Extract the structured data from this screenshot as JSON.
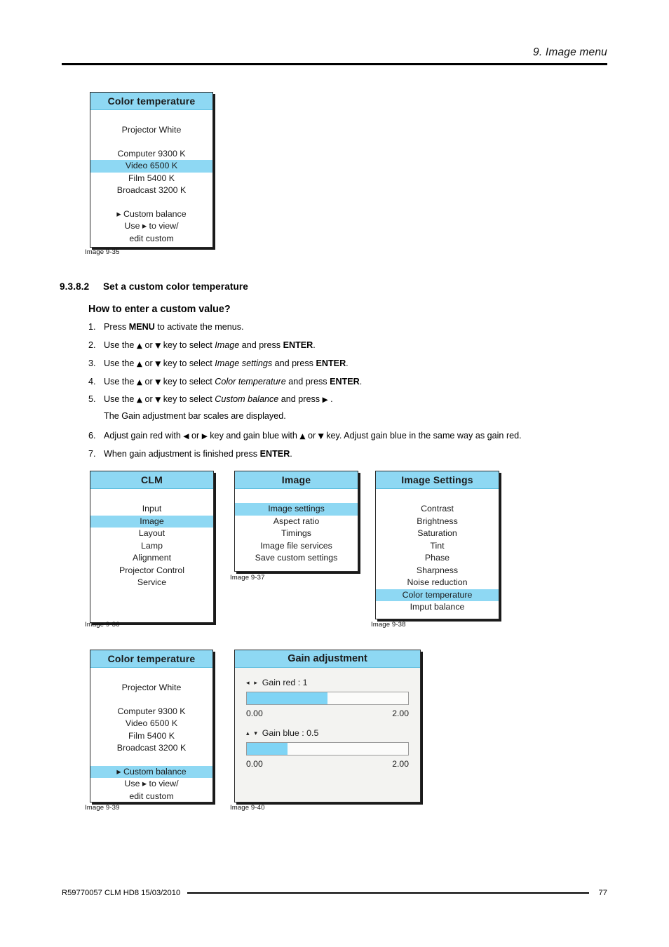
{
  "header": {
    "title": "9.  Image menu"
  },
  "section": {
    "number": "9.3.8.2",
    "title": "Set a custom color temperature",
    "subtitle": "How to enter a custom value?"
  },
  "steps": [
    {
      "n": "1.",
      "parts": [
        {
          "t": "Press ",
          "s": "plain"
        },
        {
          "t": "MENU",
          "s": "bold"
        },
        {
          "t": " to activate the menus.",
          "s": "plain"
        }
      ]
    },
    {
      "n": "2.",
      "parts": [
        {
          "t": "Use the ",
          "s": "plain"
        },
        {
          "t": "▲",
          "s": "arrow"
        },
        {
          "t": " or ",
          "s": "plain"
        },
        {
          "t": "▼",
          "s": "arrow"
        },
        {
          "t": " key to select ",
          "s": "plain"
        },
        {
          "t": "Image",
          "s": "italic"
        },
        {
          "t": " and press ",
          "s": "plain"
        },
        {
          "t": "ENTER",
          "s": "bold"
        },
        {
          "t": ".",
          "s": "plain"
        }
      ]
    },
    {
      "n": "3.",
      "parts": [
        {
          "t": "Use the ",
          "s": "plain"
        },
        {
          "t": "▲",
          "s": "arrow"
        },
        {
          "t": " or ",
          "s": "plain"
        },
        {
          "t": "▼",
          "s": "arrow"
        },
        {
          "t": " key to select ",
          "s": "plain"
        },
        {
          "t": "Image settings",
          "s": "italic"
        },
        {
          "t": " and press ",
          "s": "plain"
        },
        {
          "t": "ENTER",
          "s": "bold"
        },
        {
          "t": ".",
          "s": "plain"
        }
      ]
    },
    {
      "n": "4.",
      "parts": [
        {
          "t": "Use the ",
          "s": "plain"
        },
        {
          "t": "▲",
          "s": "arrow"
        },
        {
          "t": " or ",
          "s": "plain"
        },
        {
          "t": "▼",
          "s": "arrow"
        },
        {
          "t": " key to select ",
          "s": "plain"
        },
        {
          "t": "Color temperature",
          "s": "italic"
        },
        {
          "t": " and press ",
          "s": "plain"
        },
        {
          "t": "ENTER",
          "s": "bold"
        },
        {
          "t": ".",
          "s": "plain"
        }
      ]
    },
    {
      "n": "5.",
      "parts": [
        {
          "t": "Use the ",
          "s": "plain"
        },
        {
          "t": "▲",
          "s": "arrow"
        },
        {
          "t": " or ",
          "s": "plain"
        },
        {
          "t": "▼",
          "s": "arrow"
        },
        {
          "t": " key to select ",
          "s": "plain"
        },
        {
          "t": "Custom balance",
          "s": "italic"
        },
        {
          "t": " and press ",
          "s": "plain"
        },
        {
          "t": "▶",
          "s": "arrow"
        },
        {
          "t": " .",
          "s": "plain"
        }
      ]
    },
    {
      "n": "",
      "note": true,
      "parts": [
        {
          "t": "The Gain adjustment bar scales are displayed.",
          "s": "plain"
        }
      ]
    },
    {
      "n": "6.",
      "parts": [
        {
          "t": "Adjust gain red with ",
          "s": "plain"
        },
        {
          "t": "◀",
          "s": "arrow"
        },
        {
          "t": " or ",
          "s": "plain"
        },
        {
          "t": "▶",
          "s": "arrow"
        },
        {
          "t": " key and gain blue with ",
          "s": "plain"
        },
        {
          "t": "▲",
          "s": "arrow"
        },
        {
          "t": " or ",
          "s": "plain"
        },
        {
          "t": "▼",
          "s": "arrow"
        },
        {
          "t": " key. Adjust gain blue in the same way as gain red.",
          "s": "plain"
        }
      ]
    },
    {
      "n": "7.",
      "parts": [
        {
          "t": "When gain adjustment is finished press ",
          "s": "plain"
        },
        {
          "t": "ENTER",
          "s": "bold"
        },
        {
          "t": ".",
          "s": "plain"
        }
      ]
    }
  ],
  "menus": {
    "color_temp_top": {
      "title": "Color temperature",
      "caption": "Image 9-35",
      "rows": [
        {
          "label": "",
          "type": "spacer"
        },
        {
          "label": "Projector White",
          "selected": false
        },
        {
          "label": "",
          "type": "gap"
        },
        {
          "label": "Computer 9300 K",
          "selected": false
        },
        {
          "label": "Video 6500 K",
          "selected": true
        },
        {
          "label": "Film 5400 K",
          "selected": false
        },
        {
          "label": "Broadcast 3200 K",
          "selected": false
        },
        {
          "label": "",
          "type": "gap"
        },
        {
          "label": "▸ Custom balance",
          "selected": false
        },
        {
          "label": "Use ▸ to view/",
          "selected": false
        },
        {
          "label": "edit custom",
          "selected": false
        }
      ]
    },
    "clm": {
      "title": "CLM",
      "caption": "Image 9-36",
      "rows": [
        {
          "label": "",
          "type": "spacer"
        },
        {
          "label": "Input",
          "selected": false
        },
        {
          "label": "Image",
          "selected": true
        },
        {
          "label": "Layout",
          "selected": false
        },
        {
          "label": "Lamp",
          "selected": false
        },
        {
          "label": "Alignment",
          "selected": false
        },
        {
          "label": "Projector Control",
          "selected": false
        },
        {
          "label": "Service",
          "selected": false
        }
      ]
    },
    "image": {
      "title": "Image",
      "caption": "Image 9-37",
      "rows": [
        {
          "label": "",
          "type": "spacer"
        },
        {
          "label": "Image settings",
          "selected": true
        },
        {
          "label": "Aspect ratio",
          "selected": false
        },
        {
          "label": "Timings",
          "selected": false
        },
        {
          "label": "Image file services",
          "selected": false
        },
        {
          "label": "Save custom settings",
          "selected": false
        }
      ]
    },
    "image_settings": {
      "title": "Image Settings",
      "caption": "Image 9-38",
      "rows": [
        {
          "label": "",
          "type": "spacer"
        },
        {
          "label": "Contrast",
          "selected": false
        },
        {
          "label": "Brightness",
          "selected": false
        },
        {
          "label": "Saturation",
          "selected": false
        },
        {
          "label": "Tint",
          "selected": false
        },
        {
          "label": "Phase",
          "selected": false
        },
        {
          "label": "Sharpness",
          "selected": false
        },
        {
          "label": "Noise reduction",
          "selected": false
        },
        {
          "label": "Color temperature",
          "selected": true
        },
        {
          "label": "Imput balance",
          "selected": false
        }
      ]
    },
    "color_temp_bottom": {
      "title": "Color temperature",
      "caption": "Image 9-39",
      "rows": [
        {
          "label": "",
          "type": "spacer"
        },
        {
          "label": "Projector White",
          "selected": false
        },
        {
          "label": "",
          "type": "gap"
        },
        {
          "label": "Computer 9300 K",
          "selected": false
        },
        {
          "label": "Video 6500 K",
          "selected": false
        },
        {
          "label": "Film 5400 K",
          "selected": false
        },
        {
          "label": "Broadcast 3200 K",
          "selected": false
        },
        {
          "label": "",
          "type": "gap"
        },
        {
          "label": "▸ Custom balance",
          "selected": true
        },
        {
          "label": "Use ▸ to view/",
          "selected": false
        },
        {
          "label": "edit custom",
          "selected": false
        }
      ]
    }
  },
  "gain_panel": {
    "title": "Gain adjustment",
    "caption": "Image 9-40",
    "sliders": [
      {
        "arrows": "◂ ▸",
        "label": "Gain red : 1",
        "value": 1,
        "min_label": "0.00",
        "max_label": "2.00",
        "fill_percent": 50
      },
      {
        "arrows": "▴ ▾",
        "label": "Gain blue : 0.5",
        "value": 0.5,
        "min_label": "0.00",
        "max_label": "2.00",
        "fill_percent": 25
      }
    ]
  },
  "footer": {
    "left": "R59770057  CLM HD8  15/03/2010",
    "page": "77"
  },
  "colors": {
    "osd_highlight": "#8ed8f3",
    "osd_title_bar": "#8ed8f3",
    "slider_fill": "#7fd4f5",
    "rule": "#000000"
  }
}
